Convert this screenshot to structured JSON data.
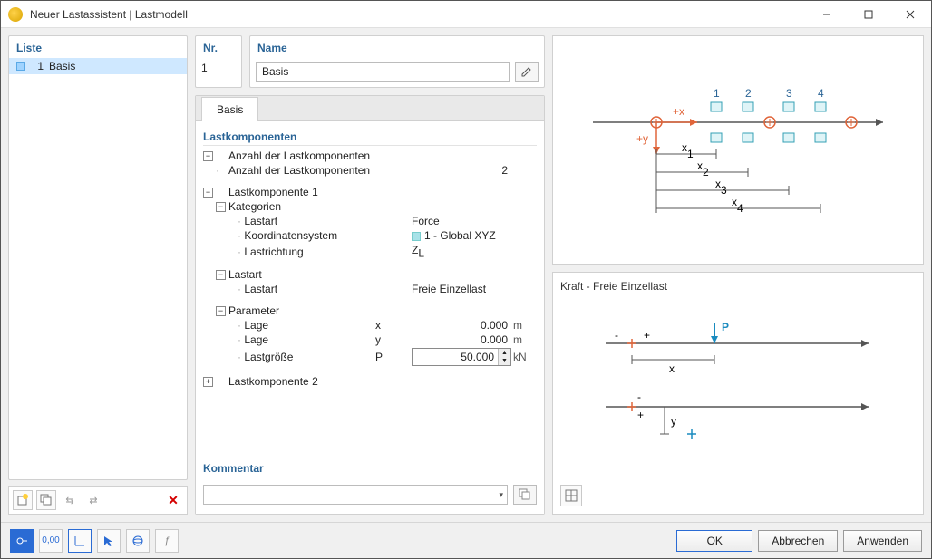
{
  "window": {
    "title": "Neuer Lastassistent | Lastmodell"
  },
  "leftpanel": {
    "heading": "Liste",
    "items": [
      {
        "num": "1",
        "label": "Basis"
      }
    ]
  },
  "nr": {
    "heading": "Nr.",
    "value": "1"
  },
  "name": {
    "heading": "Name",
    "value": "Basis"
  },
  "tabs": [
    {
      "label": "Basis",
      "active": true
    }
  ],
  "form": {
    "section": "Lastkomponenten",
    "count_group": "Anzahl der Lastkomponenten",
    "count_label": "Anzahl der Lastkomponenten",
    "count_value": "2",
    "comp1": {
      "title": "Lastkomponente 1",
      "cat_title": "Kategorien",
      "lastart_lbl": "Lastart",
      "lastart_val": "Force",
      "coord_lbl": "Koordinatensystem",
      "coord_val": "1 - Global XYZ",
      "dir_lbl": "Lastrichtung",
      "dir_val": "Z",
      "dir_sub": "L",
      "type_title": "Lastart",
      "type_lbl": "Lastart",
      "type_val": "Freie Einzellast",
      "param_title": "Parameter",
      "lage1_lbl": "Lage",
      "lage1_sym": "x",
      "lage1_val": "0.000",
      "lage1_unit": "m",
      "lage2_lbl": "Lage",
      "lage2_sym": "y",
      "lage2_val": "0.000",
      "lage2_unit": "m",
      "mag_lbl": "Lastgröße",
      "mag_sym": "P",
      "mag_val": "50.000",
      "mag_unit": "kN"
    },
    "comp2": {
      "title": "Lastkomponente 2"
    }
  },
  "comment": {
    "heading": "Kommentar",
    "value": ""
  },
  "diagram_lower_title": "Kraft - Freie Einzellast",
  "footer": {
    "ok": "OK",
    "cancel": "Abbrechen",
    "apply": "Anwenden"
  },
  "chart_data": [
    {
      "type": "diagram",
      "description": "Axis with 4 load components along +x, +y origin",
      "labels": [
        "+x",
        "+y",
        "1",
        "2",
        "3",
        "4",
        "x₁",
        "x₂",
        "x₃",
        "x₄"
      ]
    },
    {
      "type": "diagram",
      "description": "Free single load P at distance x and offset y from origin",
      "labels": [
        "P",
        "x",
        "y",
        "+",
        "-"
      ]
    }
  ]
}
